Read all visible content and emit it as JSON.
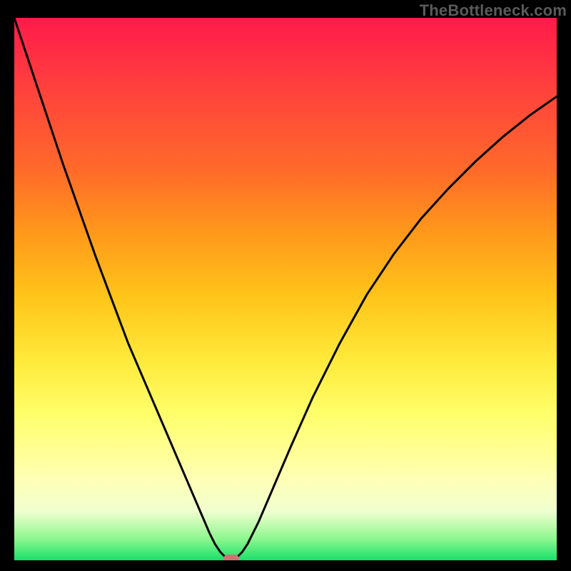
{
  "watermark": "TheBottleneck.com",
  "colors": {
    "background": "#000000",
    "curve": "#000000",
    "minimum_marker": "#d07272"
  },
  "chart_data": {
    "type": "line",
    "title": "",
    "xlabel": "",
    "ylabel": "",
    "xlim": [
      0,
      100
    ],
    "ylim": [
      0,
      100
    ],
    "x": [
      0,
      3,
      6,
      9,
      12,
      15,
      18,
      21,
      24,
      27,
      30,
      33,
      34.5,
      36,
      37,
      38,
      39,
      40,
      41,
      42,
      43,
      45,
      48,
      51,
      55,
      60,
      65,
      70,
      75,
      80,
      85,
      90,
      95,
      100
    ],
    "values": [
      100,
      91,
      82,
      73,
      64.5,
      56,
      48,
      40,
      33,
      26,
      19,
      12,
      8.5,
      5,
      3,
      1.5,
      0.5,
      0,
      0.5,
      1.5,
      3,
      7,
      14,
      21,
      30,
      40,
      49,
      56.5,
      63,
      68.5,
      73.5,
      78,
      82,
      85.5
    ],
    "minimum_point": {
      "x": 40,
      "y": 0
    },
    "background_gradient": [
      {
        "pos": 0,
        "color": "#ff1a4a"
      },
      {
        "pos": 50,
        "color": "#ffc71a"
      },
      {
        "pos": 80,
        "color": "#ffff8a"
      },
      {
        "pos": 100,
        "color": "#18e06a"
      }
    ]
  }
}
